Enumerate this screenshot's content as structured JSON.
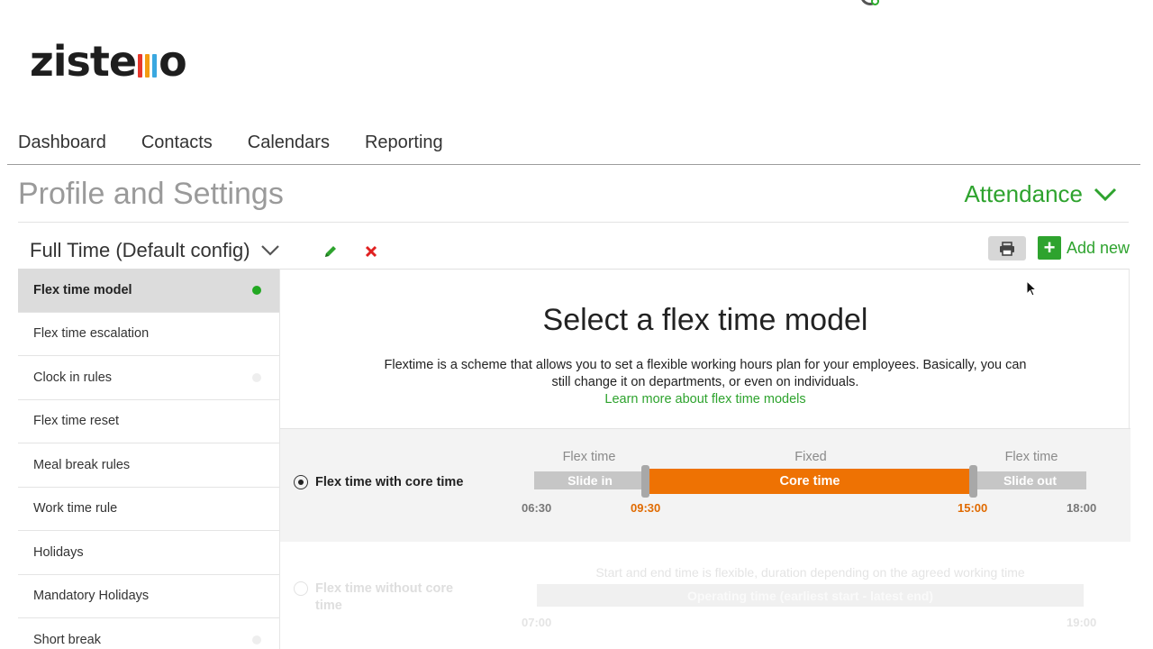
{
  "logo": {
    "text_start": "ziste",
    "text_end": "o",
    "bar_colors": [
      "#e8382d",
      "#f39c12",
      "#3aa8e0"
    ]
  },
  "nav": {
    "items": [
      "Dashboard",
      "Contacts",
      "Calendars",
      "Reporting"
    ]
  },
  "header": {
    "title": "Profile and Settings",
    "section_dropdown": "Attendance"
  },
  "config": {
    "selected": "Full Time (Default config)",
    "add_label": "Add new"
  },
  "sidebar": {
    "items": [
      {
        "label": "Flex time model",
        "active": true,
        "status": "green"
      },
      {
        "label": "Flex time escalation",
        "active": false,
        "status": "none"
      },
      {
        "label": "Clock in rules",
        "active": false,
        "status": "grey"
      },
      {
        "label": "Flex time reset",
        "active": false,
        "status": "none"
      },
      {
        "label": "Meal break rules",
        "active": false,
        "status": "none"
      },
      {
        "label": "Work time rule",
        "active": false,
        "status": "none"
      },
      {
        "label": "Holidays",
        "active": false,
        "status": "none"
      },
      {
        "label": "Mandatory Holidays",
        "active": false,
        "status": "none"
      },
      {
        "label": "Short break",
        "active": false,
        "status": "grey"
      }
    ]
  },
  "main": {
    "title": "Select a flex time model",
    "description": "Flextime is a scheme that allows you to set a flexible working hours plan for your employees. Basically, you can still change it on departments, or even on individuals.",
    "link": "Learn more about flex time models",
    "option1": {
      "label": "Flex time with core time",
      "selected": true,
      "label_left": "Flex time",
      "label_mid": "Fixed",
      "label_right": "Flex time",
      "seg_left": "Slide in",
      "seg_mid": "Core time",
      "seg_right": "Slide out",
      "t_start": "06:30",
      "t_core_start": "09:30",
      "t_core_end": "15:00",
      "t_end": "18:00"
    },
    "option2": {
      "label": "Flex time without core time",
      "selected": false,
      "caption": "Start and end time is flexible, duration depending on the agreed working time",
      "bar_text": "Operating time (earliest start - latest end)",
      "t_start": "07:00",
      "t_end": "19:00"
    }
  },
  "colors": {
    "brand_green": "#2ea32e",
    "core_orange": "#ee7203",
    "slide_grey": "#c6c6c6"
  }
}
